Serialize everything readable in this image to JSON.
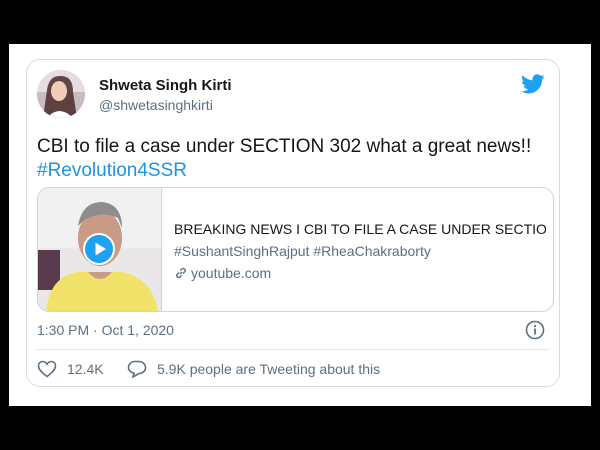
{
  "tweet": {
    "author": {
      "name": "Shweta Singh Kirti",
      "handle": "@shwetasinghkirti",
      "avatar": "avatar-photo"
    },
    "text": "CBI to file a case under SECTION 302 what a great news!!",
    "hashtag": "#Revolution4SSR",
    "card": {
      "title": "BREAKING NEWS I CBI TO FILE A CASE UNDER SECTIO...",
      "description": "#SushantSinghRajput #RheaChakraborty",
      "domain": "youtube.com",
      "thumbnail": "video-thumbnail",
      "play_icon": "play-icon"
    },
    "timestamp": "1:30 PM · Oct 1, 2020",
    "likes": "12.4K",
    "tweeting": "5.9K people are Tweeting about this"
  },
  "colors": {
    "accent": "#1da1f2",
    "link": "#1b95e0",
    "muted": "#5b7083",
    "text": "#14171a",
    "border": "#d4dde3",
    "frame": "#000000"
  },
  "icons": {
    "brand": "twitter-bird-icon",
    "info": "info-icon",
    "like": "heart-icon",
    "comment": "speech-bubble-icon",
    "link": "link-icon"
  }
}
